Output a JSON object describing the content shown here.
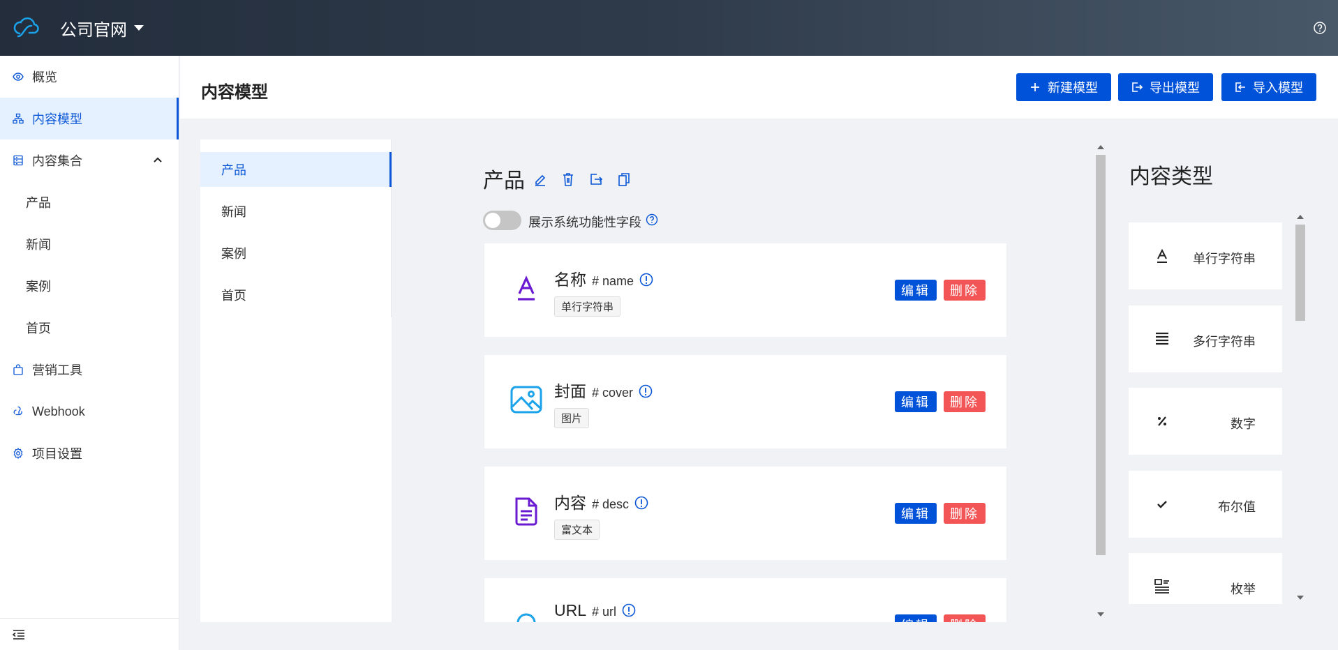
{
  "header": {
    "project_name": "公司官网"
  },
  "sidebar": {
    "items": [
      {
        "label": "概览",
        "icon": "eye-icon"
      },
      {
        "label": "内容模型",
        "icon": "model-icon",
        "active": true
      },
      {
        "label": "内容集合",
        "icon": "collection-icon",
        "expanded": true
      },
      {
        "label": "营销工具",
        "icon": "bag-icon"
      },
      {
        "label": "Webhook",
        "icon": "webhook-icon"
      },
      {
        "label": "项目设置",
        "icon": "gear-icon"
      }
    ],
    "collection_sub_items": [
      "产品",
      "新闻",
      "案例",
      "首页"
    ]
  },
  "page": {
    "title": "内容模型",
    "buttons": {
      "new_model": "新建模型",
      "export_model": "导出模型",
      "import_model": "导入模型"
    }
  },
  "models": {
    "items": [
      "产品",
      "新闻",
      "案例",
      "首页"
    ],
    "selected": "产品"
  },
  "model_detail": {
    "title": "产品",
    "toggle_label": "展示系统功能性字段",
    "toggle_on": false,
    "edit_label": "编辑",
    "delete_label": "删除",
    "fields": [
      {
        "name": "名称",
        "key": "# name",
        "type": "单行字符串",
        "icon": "text-icon"
      },
      {
        "name": "封面",
        "key": "# cover",
        "type": "图片",
        "icon": "image-icon"
      },
      {
        "name": "内容",
        "key": "# desc",
        "type": "富文本",
        "icon": "document-icon"
      },
      {
        "name": "URL",
        "key": "# url",
        "type": "",
        "icon": "link-icon"
      }
    ]
  },
  "content_types": {
    "title": "内容类型",
    "items": [
      {
        "label": "单行字符串",
        "icon": "text-icon"
      },
      {
        "label": "多行字符串",
        "icon": "lines-icon"
      },
      {
        "label": "数字",
        "icon": "percent-icon"
      },
      {
        "label": "布尔值",
        "icon": "check-icon"
      },
      {
        "label": "枚举",
        "icon": "enum-icon"
      }
    ]
  },
  "colors": {
    "primary": "#0052d9",
    "danger": "#f35455",
    "active_bg": "#e6f1ff",
    "purple_icon": "#6a1bd1",
    "cyan_icon": "#1aa3ea"
  }
}
